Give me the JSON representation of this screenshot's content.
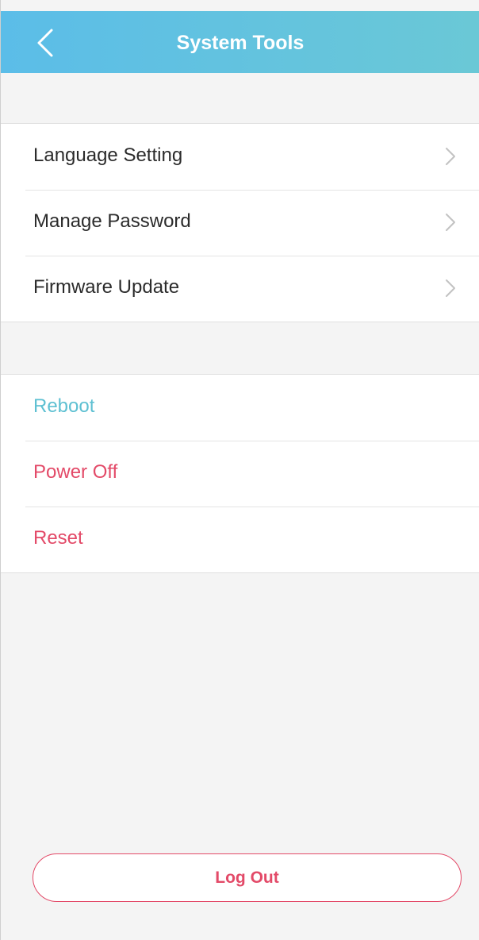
{
  "header": {
    "title": "System Tools",
    "back_icon": "chevron-left-icon",
    "background_from": "#5bbde8",
    "background_to": "#6ac8d6"
  },
  "settings_group": {
    "items": [
      {
        "label": "Language Setting",
        "icon": "chevron-right-icon"
      },
      {
        "label": "Manage Password",
        "icon": "chevron-right-icon"
      },
      {
        "label": "Firmware Update",
        "icon": "chevron-right-icon"
      }
    ]
  },
  "actions_group": {
    "items": [
      {
        "label": "Reboot",
        "color": "#5ec0d2"
      },
      {
        "label": "Power Off",
        "color": "#e34a68"
      },
      {
        "label": "Reset",
        "color": "#e34a68"
      }
    ]
  },
  "logout": {
    "label": "Log Out",
    "color": "#e34a68"
  }
}
